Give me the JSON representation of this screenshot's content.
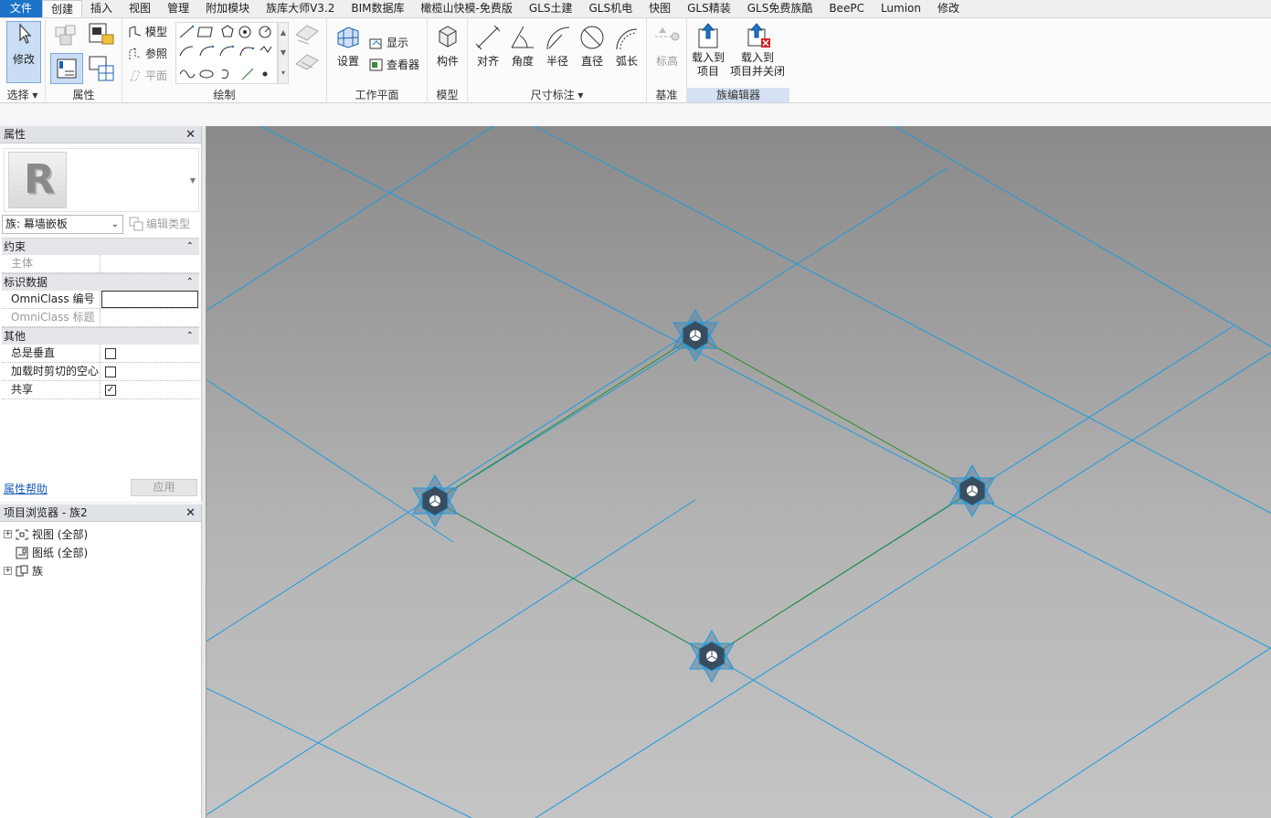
{
  "tabs": [
    "文件",
    "创建",
    "插入",
    "视图",
    "管理",
    "附加模块",
    "族库大师V3.2",
    "BIM数据库",
    "橄榄山快模-免费版",
    "GLS土建",
    "GLS机电",
    "快图",
    "GLS精装",
    "GLS免费族酷",
    "BeePC",
    "Lumion",
    "修改"
  ],
  "ribbon": {
    "select": {
      "modify": "修改",
      "label": "选择"
    },
    "properties": {
      "label": "属性"
    },
    "draw": {
      "model": "模型",
      "reference": "参照",
      "plane": "平面",
      "label": "绘制"
    },
    "workplane": {
      "set": "设置",
      "show": "显示",
      "viewer": "查看器",
      "label": "工作平面"
    },
    "model": {
      "component": "构件",
      "label": "模型"
    },
    "dimension": {
      "aligned": "对齐",
      "angular": "角度",
      "radial": "半径",
      "diameter": "直径",
      "arc": "弧长",
      "label": "尺寸标注"
    },
    "datum": {
      "elevation": "标高",
      "label": "基准"
    },
    "family_editor": {
      "load_line1": "载入到",
      "load_line2": "项目",
      "load_close_line1": "载入到",
      "load_close_line2": "项目并关闭",
      "label": "族编辑器"
    }
  },
  "properties": {
    "title": "属性",
    "family_selector": "族: 幕墙嵌板",
    "edit_type": "编辑类型",
    "sections": {
      "constraints": "约束",
      "host": "主体",
      "identity": "标识数据",
      "omni_number": "OmniClass 编号",
      "omni_title": "OmniClass 标题",
      "other": "其他",
      "always_vertical": "总是垂直",
      "cut_void": "加载时剪切的空心",
      "shared": "共享",
      "shared_check": "✓"
    },
    "help": "属性帮助",
    "apply": "应用"
  },
  "browser": {
    "title": "项目浏览器 - 族2",
    "items": [
      "视图 (全部)",
      "图纸 (全部)",
      "族"
    ]
  },
  "colors": {
    "accent": "#1c73c9",
    "grid_line": "#1a9be0",
    "green_line": "#2e8b2e"
  }
}
